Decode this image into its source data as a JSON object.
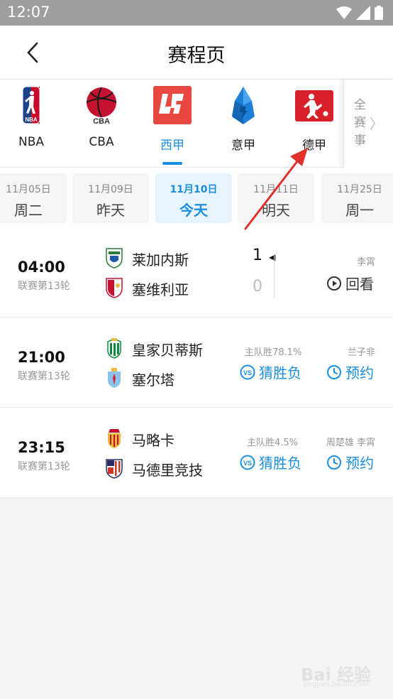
{
  "status_bar": {
    "time": "12:07"
  },
  "header": {
    "title": "赛程页"
  },
  "leagues": [
    {
      "name": "NBA",
      "icon": "nba-logo-icon",
      "active": false
    },
    {
      "name": "CBA",
      "icon": "cba-logo-icon",
      "active": false
    },
    {
      "name": "西甲",
      "icon": "laliga-logo-icon",
      "active": true
    },
    {
      "name": "意甲",
      "icon": "serie-a-logo-icon",
      "active": false
    },
    {
      "name": "德甲",
      "icon": "bundesliga-logo-icon",
      "active": false
    }
  ],
  "all_leagues": {
    "label": "全赛事"
  },
  "date_tabs": [
    {
      "date": "11月05日",
      "weekday": "周二",
      "active": false
    },
    {
      "date": "11月09日",
      "weekday": "昨天",
      "active": false
    },
    {
      "date": "11月10日",
      "weekday": "今天",
      "active": true
    },
    {
      "date": "11月11日",
      "weekday": "明天",
      "active": false
    },
    {
      "date": "11月25日",
      "weekday": "周一",
      "active": false
    }
  ],
  "matches": [
    {
      "time": "04:00",
      "round": "联赛第13轮",
      "home": {
        "name": "莱加内斯",
        "score": "1"
      },
      "away": {
        "name": "塞维利亚",
        "score": "0"
      },
      "commentator": "李霄",
      "action_label": "回看"
    },
    {
      "time": "21:00",
      "round": "联赛第13轮",
      "home": {
        "name": "皇家贝蒂斯"
      },
      "away": {
        "name": "塞尔塔"
      },
      "odds": "主队胜78.1%",
      "guess_label": "猜胜负",
      "commentator": "兰子非",
      "action_label": "预约"
    },
    {
      "time": "23:15",
      "round": "联赛第13轮",
      "home": {
        "name": "马略卡"
      },
      "away": {
        "name": "马德里竞技"
      },
      "odds": "主队胜4.5%",
      "guess_label": "猜胜负",
      "commentator": "周楚雄 李霄",
      "action_label": "预约"
    }
  ],
  "colors": {
    "accent": "#1a8fe0",
    "annotation_arrow": "#e0312b",
    "laliga": "#e8483f",
    "bundesliga": "#d8202a",
    "serie_a": "#1e7fd6"
  },
  "watermark": {
    "text": "Bai 经验",
    "sub": "jingyan.baidu.com"
  }
}
